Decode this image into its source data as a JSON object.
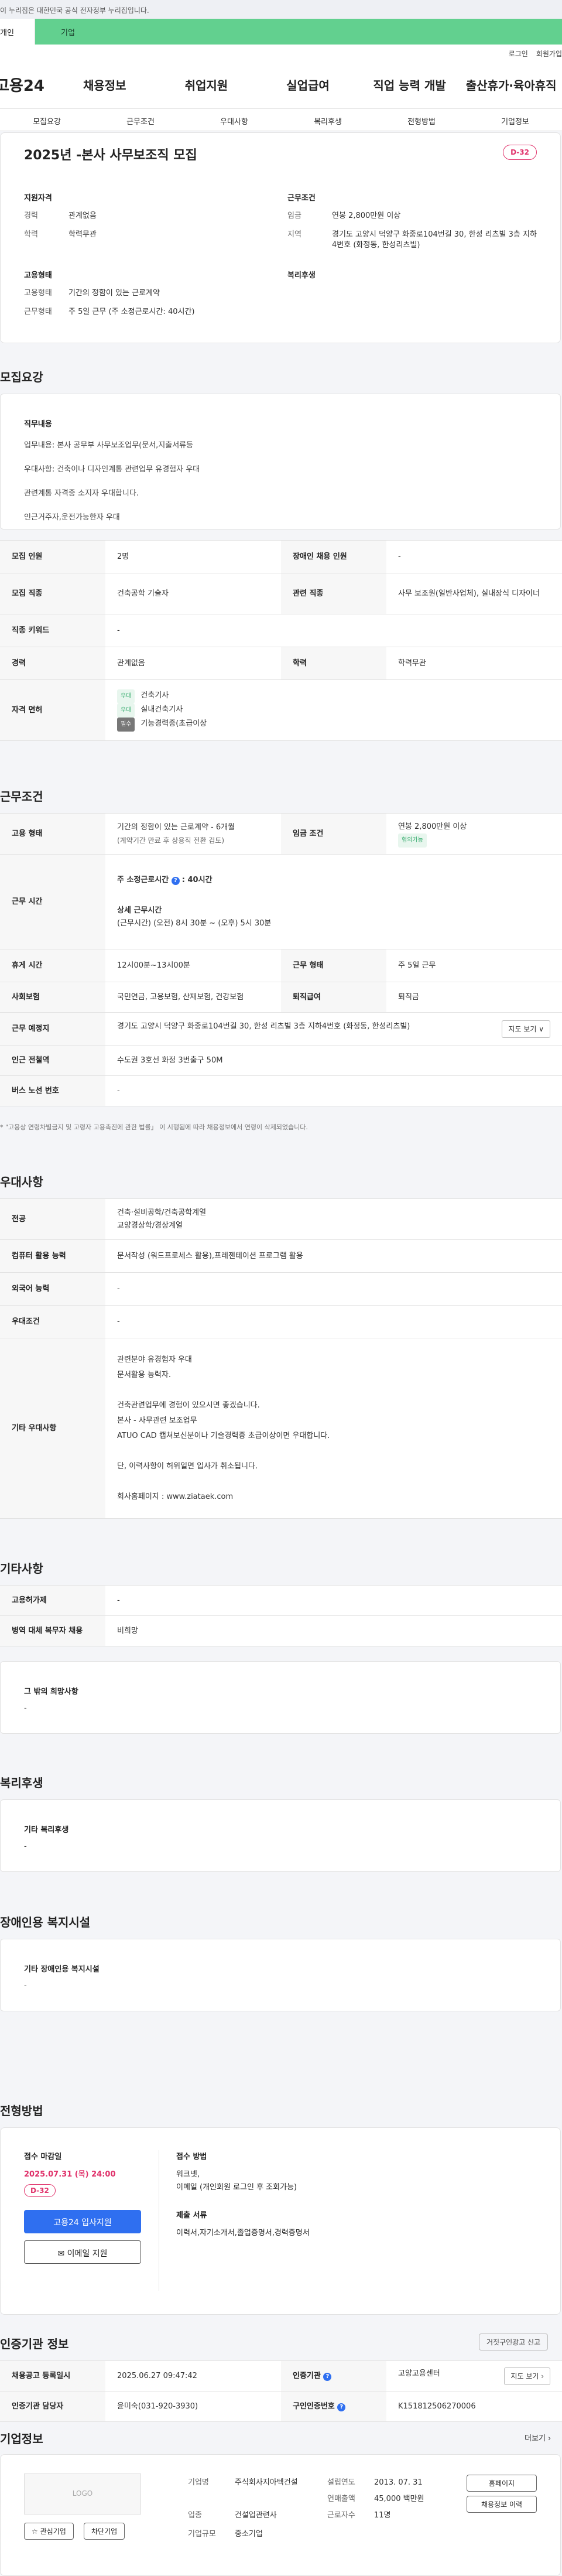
{
  "gov_banner": "이 누리집은 대한민국 공식 전자정부 누리집입니다.",
  "tabs": [
    "개인",
    "기업"
  ],
  "util": [
    "로그인",
    "회원가입"
  ],
  "logo": "고용24",
  "gnb": [
    "채용정보",
    "취업지원",
    "실업급여",
    "직업 능력 개발",
    "출산휴가·육아휴직"
  ],
  "subnav": [
    "모집요강",
    "근무조건",
    "우대사항",
    "복리후생",
    "전형방법",
    "기업정보"
  ],
  "job": {
    "title": "2025년 -본사 사무보조직 모집",
    "dday": "D-32",
    "qual_title": "지원자격",
    "career_k": "경력",
    "career_v": "관계없음",
    "edu_k": "학력",
    "edu_v": "학력무관",
    "cond_title": "근무조건",
    "wage_k": "임금",
    "wage_v": "연봉 2,800만원 이상",
    "loc_k": "지역",
    "loc_v": "경기도 고양시 덕양구 화중로104번길 30, 한성 리츠빌 3층 지하4번호 (화정동, 한성리츠빌)",
    "emp_title": "고용형태",
    "emptype_k": "고용형태",
    "emptype_v": "기간의 정함이 있는 근로계약",
    "hours_k": "근무형태",
    "hours_v": "주 5일 근무 (주 소정근로시간: 40시간)",
    "welfare_title": "복리후생"
  },
  "req": {
    "title": "모집요강",
    "duty_title": "직무내용",
    "lines": [
      "업무내용: 본사 공무부 사무보조업무(문서,지출서류등",
      "우대사항: 건축이나 디자인계통 관련업무 유경험자 우대",
      "관련계통 자격증 소지자 우대합니다.",
      "인근거주자,운전가능한자 우대"
    ],
    "rows": [
      {
        "k1": "모집 인원",
        "v1": "2명",
        "k2": "장애인 채용 인원",
        "v2": "-"
      },
      {
        "k1": "모집 직종",
        "v1": "건축공학 기술자",
        "k2": "관련 직종",
        "v2": "사무 보조원(일반사업체), 실내장식 디자이너"
      },
      {
        "k1": "직종 키워드",
        "v1": "-"
      },
      {
        "k1": "경력",
        "v1": "관계없음",
        "k2": "학력",
        "v2": "학력무관"
      }
    ],
    "license_k": "자격 면허",
    "licenses": [
      {
        "tag": "우대",
        "name": "건축기사"
      },
      {
        "tag": "우대",
        "name": "실내건축기사"
      },
      {
        "tag": "필수",
        "name": "기능경력증(초급이상"
      }
    ]
  },
  "cond": {
    "title": "근무조건",
    "emp_k": "고용 형태",
    "emp_v": "기간의 정함이 있는 근로계약 - 6개월",
    "emp_sub": "(계약기간 만료 후 상용직 전환 검토)",
    "wage_k": "임금 조건",
    "wage_v": "연봉 2,800만원 이상",
    "wage_tag": "협의가능",
    "time_k": "근무 시간",
    "week_hours": "주 소정근로시간 ",
    "week_hours_v": "40시간",
    "detail_title": "상세 근무시간",
    "detail_v": "(근무시간) (오전) 8시 30분 ~ (오후) 5시 30분",
    "rest_k": "휴게 시간",
    "rest_v": "12시00분~13시00분",
    "shape_k": "근무 형태",
    "shape_v": "주 5일 근무",
    "ins_k": "사회보험",
    "ins_v": "국민연금, 고용보험, 산재보험, 건강보험",
    "ret_k": "퇴직급여",
    "ret_v": "퇴직금",
    "place_k": "근무 예정지",
    "place_v": "경기도 고양시 덕양구 화중로104번길 30, 한성 리츠빌 3층 지하4번호 (화정동, 한성리츠빌)",
    "map_btn": "지도 보기 ∨",
    "subway_k": "인근 전철역",
    "subway_v": "수도권 3호선 화정 3번출구 50M",
    "bus_k": "버스 노선 번호",
    "bus_v": "-",
    "note": "* \"고용상 연령차별금지 및 고령자 고용촉진에 관한 법률」 이 시행됨에 따라 채용정보에서 연령이 삭제되었습니다."
  },
  "pref": {
    "title": "우대사항",
    "major_k": "전공",
    "major_v1": "건축·설비공학/건축공학계열",
    "major_v2": "교양경상학/경상계열",
    "pc_k": "컴퓨터 활용 능력",
    "pc_v": "문서작성 (워드프로세스 활용),프레젠테이션 프로그램 활용",
    "lang_k": "외국어 능력",
    "lang_v": "-",
    "cond_k": "우대조건",
    "cond_v": "-",
    "etc_k": "기타 우대사항",
    "etc_lines": [
      "관련분야 유경험자 우대",
      "문서활용 능력자.",
      "",
      "건축관련업무에 경험이 있으시면 좋겠습니다.",
      "본사 - 사무관련 보조업무",
      "ATUO CAD 캡쳐보신분이나 기술경력증 초급이상이면 우대합니다.",
      "",
      "단, 이력사항이 허위일면 입사가 취소됩니다.",
      "",
      "회사홈페이지 : www.ziataek.com"
    ]
  },
  "etc": {
    "title": "기타사항",
    "emp_k": "고용허가제",
    "emp_v": "-",
    "mil_k": "병역 대체 복무자 채용",
    "mil_v": "비희망",
    "wish_title": "그 밖의 희망사항",
    "wish_v": "-"
  },
  "welfare": {
    "title": "복리후생",
    "sub": "기타 복리후생",
    "v": "-"
  },
  "disab": {
    "title": "장애인용 복지시설",
    "sub": "기타 장애인용 복지시설",
    "v": "-"
  },
  "apply": {
    "title": "전형방법",
    "deadline_k": "접수 마감일",
    "deadline_v": "2025.07.31 (목) 24:00",
    "dday": "D-32",
    "btn": "고용24 입사지원",
    "mail_btn": "✉ 이메일 지원",
    "method_k": "접수 방법",
    "method_v1": "워크넷,",
    "method_v2": "이메일 (개인회원 로그인 후 조회가능)",
    "docs_k": "제출 서류",
    "docs_v": "이력서,자기소개서,졸업증명서,경력증명서"
  },
  "agency": {
    "title": "인증기관 정보",
    "report_btn": "거짓구인광고 신고",
    "reg_k": "채용공고 등록일시",
    "reg_v": "2025.06.27 09:47:42",
    "org_k": "인증기관",
    "org_v": "고양고용센터",
    "map_btn": "지도 보기 ›",
    "mgr_k": "인증기관 담당자",
    "mgr_v": "윤미숙(031-920-3930)",
    "id_k": "구인인증번호",
    "id_v": "K151812506270006"
  },
  "company": {
    "title": "기업정보",
    "more": "더보기 ›",
    "logo": "LOGO",
    "fav": "☆ 관심기업",
    "block": "차단기업",
    "name_k": "기업명",
    "name_v": "주식회사지아텍건설",
    "est_k": "설립연도",
    "est_v": "2013. 07. 31",
    "biz_k": "업종",
    "biz_v": "건설업관련사",
    "sales_k": "연매출액",
    "sales_v": "45,000 백만원",
    "type_k": "기업규모",
    "type_v": "중소기업",
    "emp_k": "근로자수",
    "emp_v": "11명",
    "home_btn": "홈페이지",
    "list_btn": "채용정보 이력"
  }
}
